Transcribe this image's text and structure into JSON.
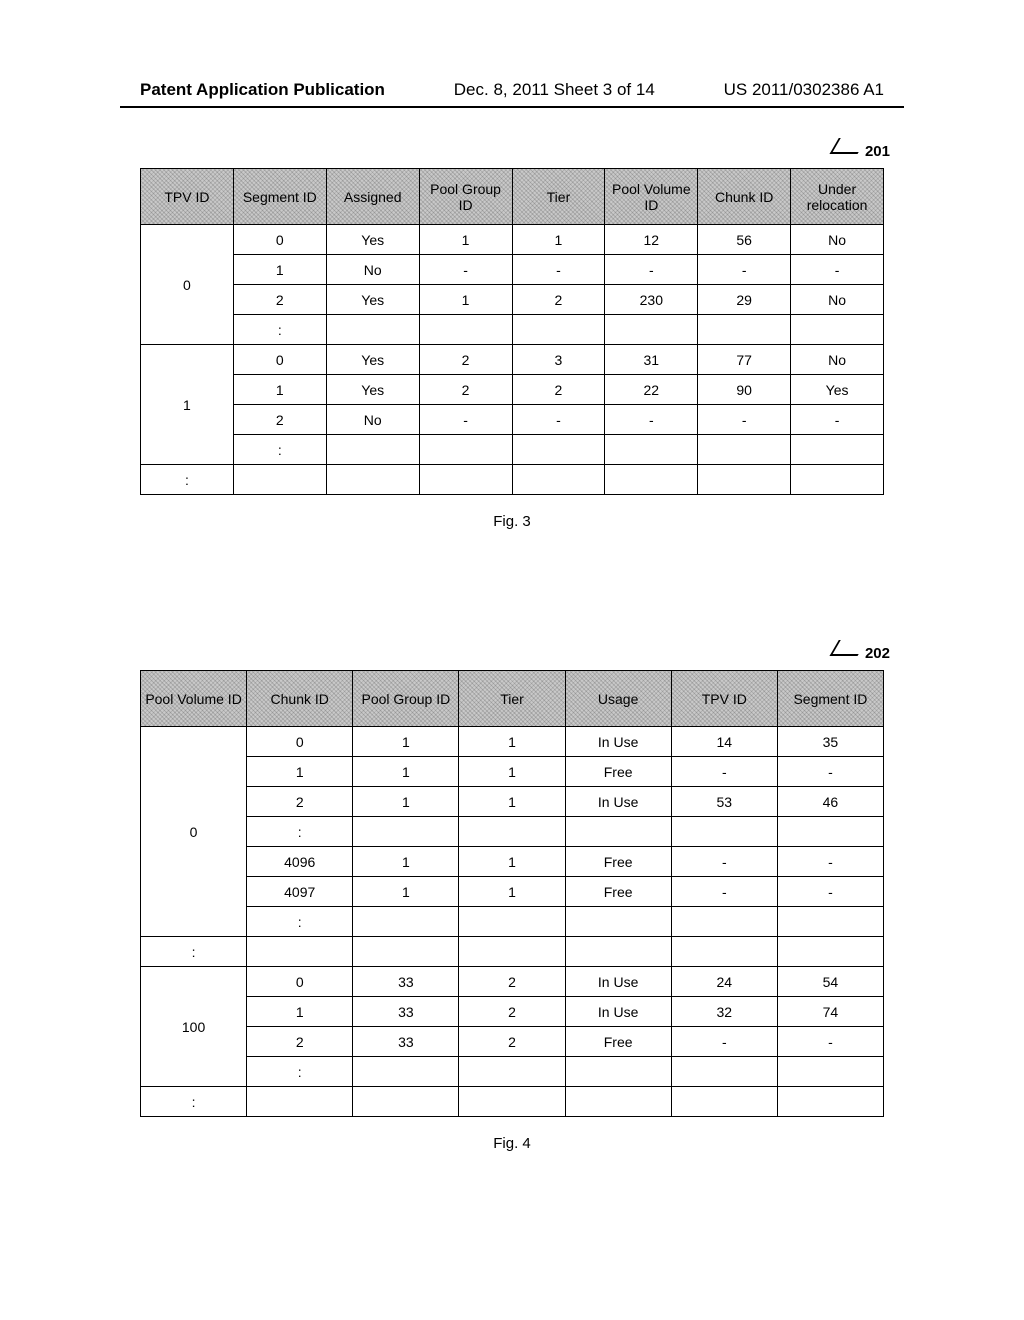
{
  "header": {
    "left": "Patent Application Publication",
    "center": "Dec. 8, 2011  Sheet 3 of 14",
    "right": "US 2011/0302386 A1"
  },
  "fig3": {
    "ref": "201",
    "caption": "Fig. 3",
    "headers": [
      "TPV ID",
      "Segment ID",
      "Assigned",
      "Pool Group ID",
      "Tier",
      "Pool Volume ID",
      "Chunk ID",
      "Under relocation"
    ],
    "groups": [
      {
        "id": "0",
        "rows": [
          [
            "0",
            "Yes",
            "1",
            "1",
            "12",
            "56",
            "No"
          ],
          [
            "1",
            "No",
            "-",
            "-",
            "-",
            "-",
            "-"
          ],
          [
            "2",
            "Yes",
            "1",
            "2",
            "230",
            "29",
            "No"
          ],
          [
            ":",
            "",
            "",
            "",
            "",
            "",
            ""
          ]
        ]
      },
      {
        "id": "1",
        "rows": [
          [
            "0",
            "Yes",
            "2",
            "3",
            "31",
            "77",
            "No"
          ],
          [
            "1",
            "Yes",
            "2",
            "2",
            "22",
            "90",
            "Yes"
          ],
          [
            "2",
            "No",
            "-",
            "-",
            "-",
            "-",
            "-"
          ],
          [
            ":",
            "",
            "",
            "",
            "",
            "",
            ""
          ]
        ]
      },
      {
        "id": ":",
        "rows": [
          [
            "",
            "",
            "",
            "",
            "",
            "",
            ""
          ]
        ]
      }
    ]
  },
  "fig4": {
    "ref": "202",
    "caption": "Fig. 4",
    "headers": [
      "Pool Volume ID",
      "Chunk ID",
      "Pool Group ID",
      "Tier",
      "Usage",
      "TPV ID",
      "Segment ID"
    ],
    "groups": [
      {
        "id": "0",
        "rows": [
          [
            "0",
            "1",
            "1",
            "In Use",
            "14",
            "35"
          ],
          [
            "1",
            "1",
            "1",
            "Free",
            "-",
            "-"
          ],
          [
            "2",
            "1",
            "1",
            "In Use",
            "53",
            "46"
          ],
          [
            ":",
            "",
            "",
            "",
            "",
            ""
          ],
          [
            "4096",
            "1",
            "1",
            "Free",
            "-",
            "-"
          ],
          [
            "4097",
            "1",
            "1",
            "Free",
            "-",
            "-"
          ],
          [
            ":",
            "",
            "",
            "",
            "",
            ""
          ]
        ]
      },
      {
        "id": ":",
        "rows": [
          [
            "",
            "",
            "",
            "",
            "",
            ""
          ]
        ]
      },
      {
        "id": "100",
        "rows": [
          [
            "0",
            "33",
            "2",
            "In Use",
            "24",
            "54"
          ],
          [
            "1",
            "33",
            "2",
            "In Use",
            "32",
            "74"
          ],
          [
            "2",
            "33",
            "2",
            "Free",
            "-",
            "-"
          ],
          [
            ":",
            "",
            "",
            "",
            "",
            ""
          ]
        ]
      },
      {
        "id": ":",
        "rows": [
          [
            "",
            "",
            "",
            "",
            "",
            ""
          ]
        ]
      }
    ]
  },
  "chart_data": [
    {
      "type": "table",
      "title": "Fig. 3 — TPV Segment Mapping (ref 201)",
      "columns": [
        "TPV ID",
        "Segment ID",
        "Assigned",
        "Pool Group ID",
        "Tier",
        "Pool Volume ID",
        "Chunk ID",
        "Under relocation"
      ],
      "rows": [
        [
          "0",
          "0",
          "Yes",
          "1",
          "1",
          "12",
          "56",
          "No"
        ],
        [
          "0",
          "1",
          "No",
          "-",
          "-",
          "-",
          "-",
          "-"
        ],
        [
          "0",
          "2",
          "Yes",
          "1",
          "2",
          "230",
          "29",
          "No"
        ],
        [
          "0",
          ":",
          "",
          "",
          "",
          "",
          "",
          ""
        ],
        [
          "1",
          "0",
          "Yes",
          "2",
          "3",
          "31",
          "77",
          "No"
        ],
        [
          "1",
          "1",
          "Yes",
          "2",
          "2",
          "22",
          "90",
          "Yes"
        ],
        [
          "1",
          "2",
          "No",
          "-",
          "-",
          "-",
          "-",
          "-"
        ],
        [
          "1",
          ":",
          "",
          "",
          "",
          "",
          "",
          ""
        ],
        [
          ":",
          "",
          "",
          "",
          "",
          "",
          "",
          ""
        ]
      ]
    },
    {
      "type": "table",
      "title": "Fig. 4 — Pool Volume Chunk Mapping (ref 202)",
      "columns": [
        "Pool Volume ID",
        "Chunk ID",
        "Pool Group ID",
        "Tier",
        "Usage",
        "TPV ID",
        "Segment ID"
      ],
      "rows": [
        [
          "0",
          "0",
          "1",
          "1",
          "In Use",
          "14",
          "35"
        ],
        [
          "0",
          "1",
          "1",
          "1",
          "Free",
          "-",
          "-"
        ],
        [
          "0",
          "2",
          "1",
          "1",
          "In Use",
          "53",
          "46"
        ],
        [
          "0",
          ":",
          "",
          "",
          "",
          "",
          ""
        ],
        [
          "0",
          "4096",
          "1",
          "1",
          "Free",
          "-",
          "-"
        ],
        [
          "0",
          "4097",
          "1",
          "1",
          "Free",
          "-",
          "-"
        ],
        [
          "0",
          ":",
          "",
          "",
          "",
          "",
          ""
        ],
        [
          ":",
          "",
          "",
          "",
          "",
          "",
          ""
        ],
        [
          "100",
          "0",
          "33",
          "2",
          "In Use",
          "24",
          "54"
        ],
        [
          "100",
          "1",
          "33",
          "2",
          "In Use",
          "32",
          "74"
        ],
        [
          "100",
          "2",
          "33",
          "2",
          "Free",
          "-",
          "-"
        ],
        [
          "100",
          ":",
          "",
          "",
          "",
          "",
          ""
        ],
        [
          ":",
          "",
          "",
          "",
          "",
          "",
          ""
        ]
      ]
    }
  ]
}
